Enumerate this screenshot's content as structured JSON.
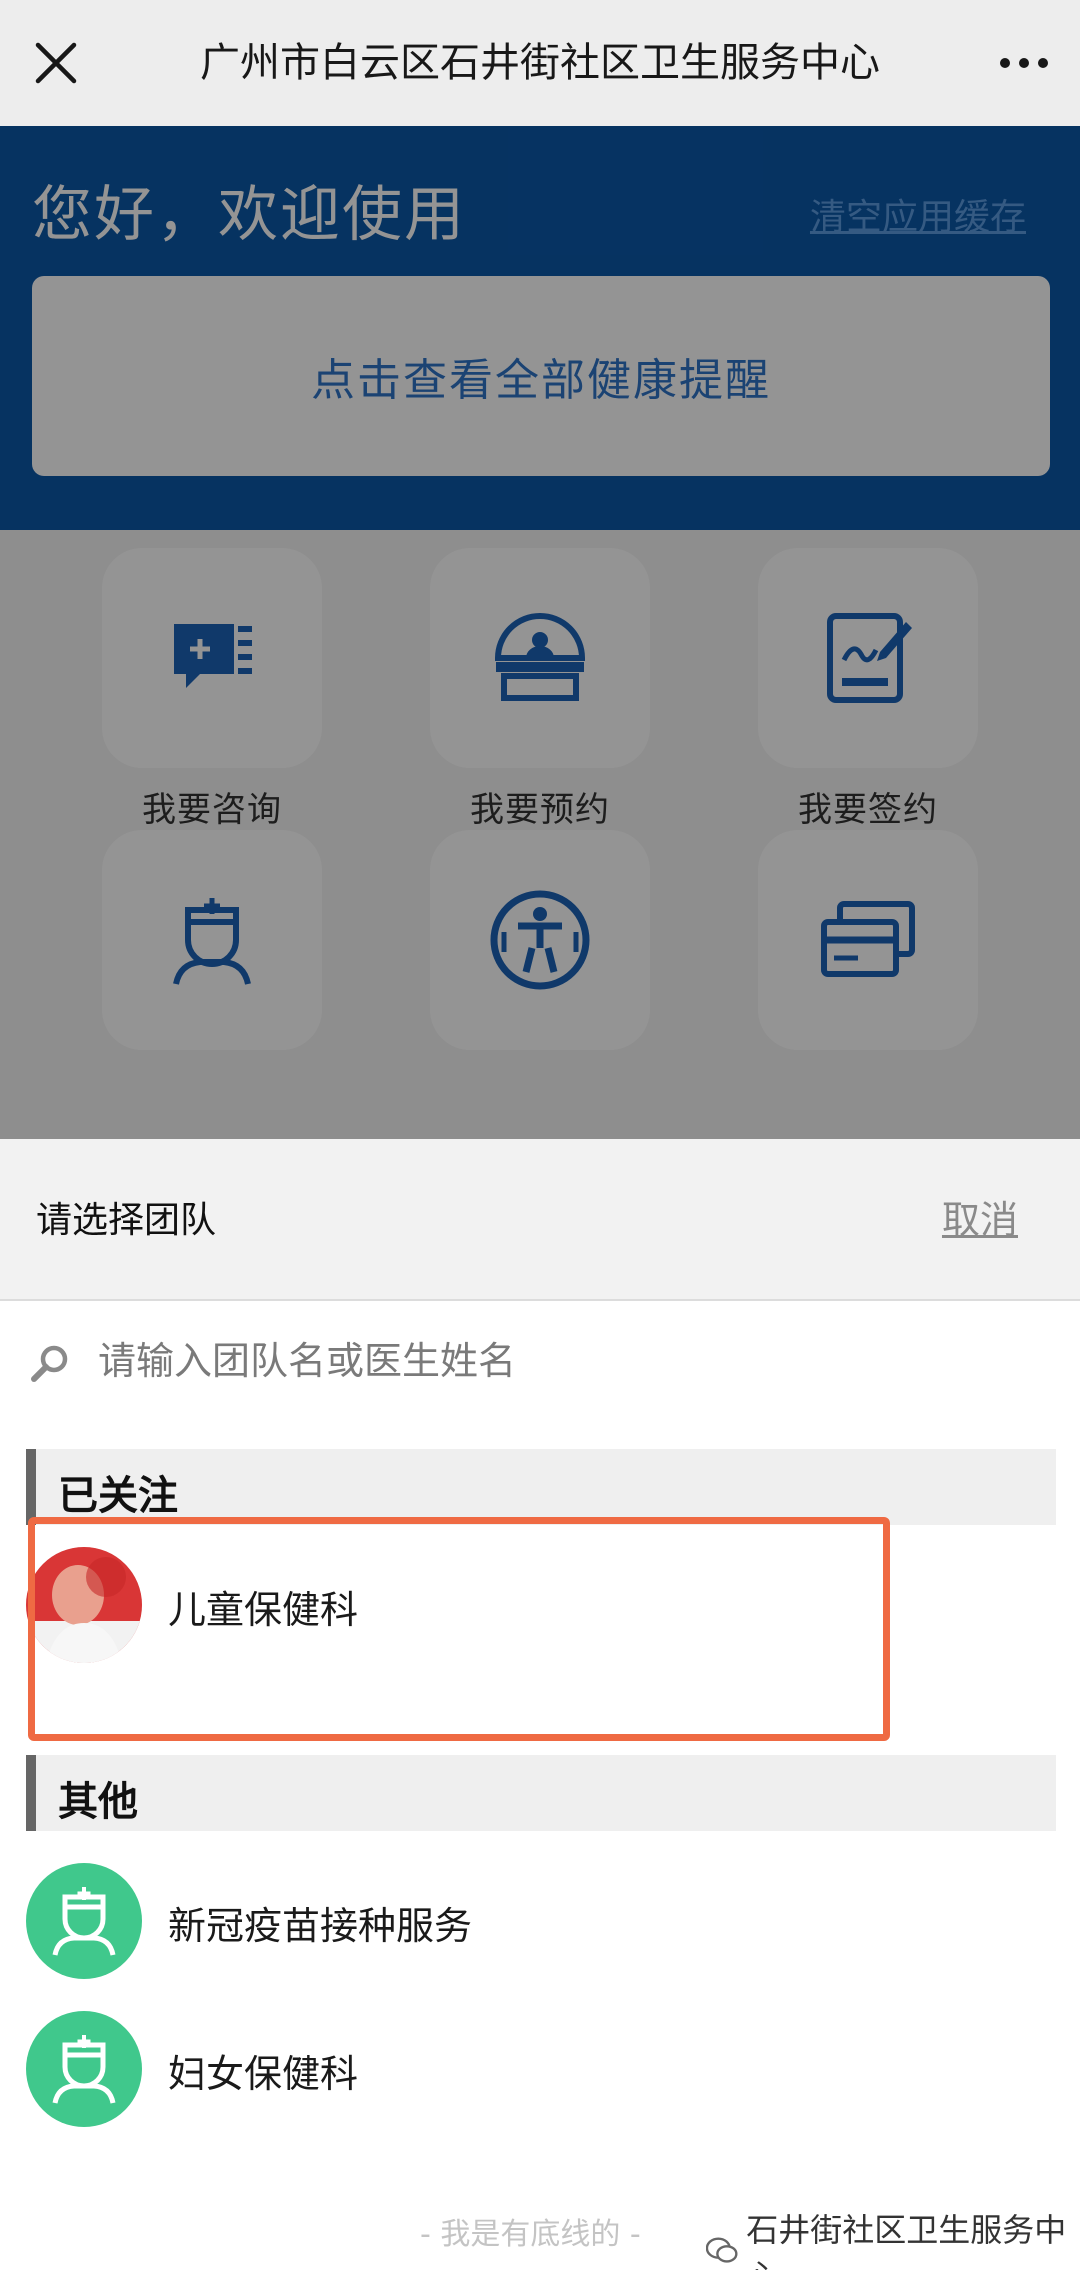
{
  "nav": {
    "title": "广州市白云区石井街社区卫生服务中心",
    "close_icon": "close-icon",
    "more_icon": "more-icon"
  },
  "home": {
    "greeting": "您好，欢迎使用",
    "clear_cache": "清空应用缓存",
    "reminder": "点击查看全部健康提醒",
    "tiles": [
      {
        "label": "我要咨询",
        "icon": "consult-icon"
      },
      {
        "label": "我要预约",
        "icon": "reception-icon"
      },
      {
        "label": "我要签约",
        "icon": "sign-icon"
      },
      {
        "label": "",
        "icon": "doctor-icon"
      },
      {
        "label": "",
        "icon": "accessibility-icon"
      },
      {
        "label": "",
        "icon": "cards-icon"
      }
    ]
  },
  "sheet": {
    "title": "请选择团队",
    "cancel": "取消",
    "search_placeholder": "请输入团队名或医生姓名",
    "followed": {
      "header": "已关注",
      "items": [
        {
          "name": "儿童保健科"
        }
      ]
    },
    "others": {
      "header": "其他",
      "items": [
        {
          "name": "新冠疫苗接种服务"
        },
        {
          "name": "妇女保健科"
        }
      ]
    }
  },
  "footer": {
    "note": "- 我是有底线的 -",
    "watermark": "石井街社区卫生服务中心"
  },
  "colors": {
    "brand_blue": "#0b58a8",
    "avatar_green": "#40c88c",
    "highlight": "#ef6a43"
  }
}
